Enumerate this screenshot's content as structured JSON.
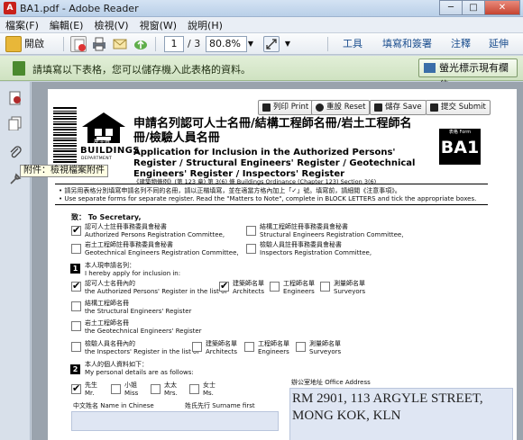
{
  "window": {
    "title": "BA1.pdf - Adobe Reader",
    "min": "─",
    "max": "□",
    "close": "✕"
  },
  "menu": [
    "檔案(F)",
    "編輯(E)",
    "檢視(V)",
    "視窗(W)",
    "說明(H)"
  ],
  "toolbar": {
    "open_label": "開啟",
    "page_current": "1",
    "page_total": "/ 3",
    "zoom": "80.8%",
    "tools": "工具",
    "fill_sign": "填寫和簽署",
    "comment": "注釋",
    "extend": "延伸"
  },
  "formbar": {
    "message": "請填寫以下表格，您可以儲存機入此表格的資料。",
    "highlight_button": "螢光標示現有欄位"
  },
  "sidebar": {
    "tooltip": "附件：檢視檔案附件"
  },
  "page": {
    "buttons": {
      "print": "列印 Print",
      "reset": "重設 Reset",
      "save": "儲存 Save",
      "submit": "提交 Submit"
    },
    "logo": {
      "name": "BUILDINGS",
      "sub": "DEPARTMENT",
      "chinese": "屋宇署"
    },
    "title_zh": "申請名列認可人士名冊/結構工程師名冊/岩土工程師名冊/檢驗人員名冊",
    "title_en": "Application for Inclusion in the Authorized Persons' Register / Structural Engineers' Register / Geotechnical Engineers' Register / Inspectors' Register",
    "ordinance": "《建築物條例》(第 123 章) 第 3(6) 條    Buildings Ordinance (Chapter 123) Section 3(6)",
    "form_code": {
      "label": "表格 Form",
      "code": "BA1"
    },
    "note_zh": "• 請另用表格分別填寫申請名列不同的名冊，請以正楷填寫，並在適當方格內加上「✓」號。填寫前，請細閱《注意事項》。",
    "note_en": "• Use separate forms for separate register. Read the \"Matters to Note\", complete in BLOCK LETTERS and tick the appropriate boxes.",
    "to": "致：  To Secretary,",
    "committees": [
      {
        "zh": "認可人士註冊事務委員會秘書",
        "en": "Authorized Persons Registration Committee,"
      },
      {
        "zh": "結構工程師註冊事務委員會秘書",
        "en": "Structural Engineers Registration Committee,"
      },
      {
        "zh": "岩土工程師註冊事務委員會秘書",
        "en": "Geotechnical Engineers Registration Committee,"
      },
      {
        "zh": "檢驗人員註冊事務委員會秘書",
        "en": "Inspectors Registration Committee,"
      }
    ],
    "section1": {
      "num": "1",
      "zh": "本人現申請名列：",
      "en": "I hereby apply for inclusion in:",
      "ap_zh": "認可人士名冊內的",
      "ap_en": "the Authorized Persons' Register in the list of",
      "arch_zh": "建築師名單",
      "arch_en": "Architects",
      "eng_zh": "工程師名單",
      "eng_en": "Engineers",
      "surv_zh": "測量師名單",
      "surv_en": "Surveyors",
      "se_zh": "結構工程師名冊",
      "se_en": "the Structural Engineers' Register",
      "ge_zh": "岩土工程師名冊",
      "ge_en": "the Geotechnical Engineers' Register",
      "ir_zh": "檢驗人員名冊內的",
      "ir_en": "the Inspectors' Register in the list of"
    },
    "section2": {
      "num": "2",
      "zh": "本人的個人資料如下：",
      "en": "My personal details are as follows:",
      "titles": [
        {
          "zh": "先生",
          "en": "Mr."
        },
        {
          "zh": "小姐",
          "en": "Miss"
        },
        {
          "zh": "太太",
          "en": "Mrs."
        },
        {
          "zh": "女士",
          "en": "Ms."
        }
      ],
      "name_label": "中文姓名  Name in Chinese",
      "surname_label": "姓氏先行  Surname first",
      "office_label": "辦公室地址 Office Address",
      "address_line1": "RM 2901, 113 ARGYLE STREET,",
      "address_line2": "MONG KOK, KLN"
    }
  }
}
